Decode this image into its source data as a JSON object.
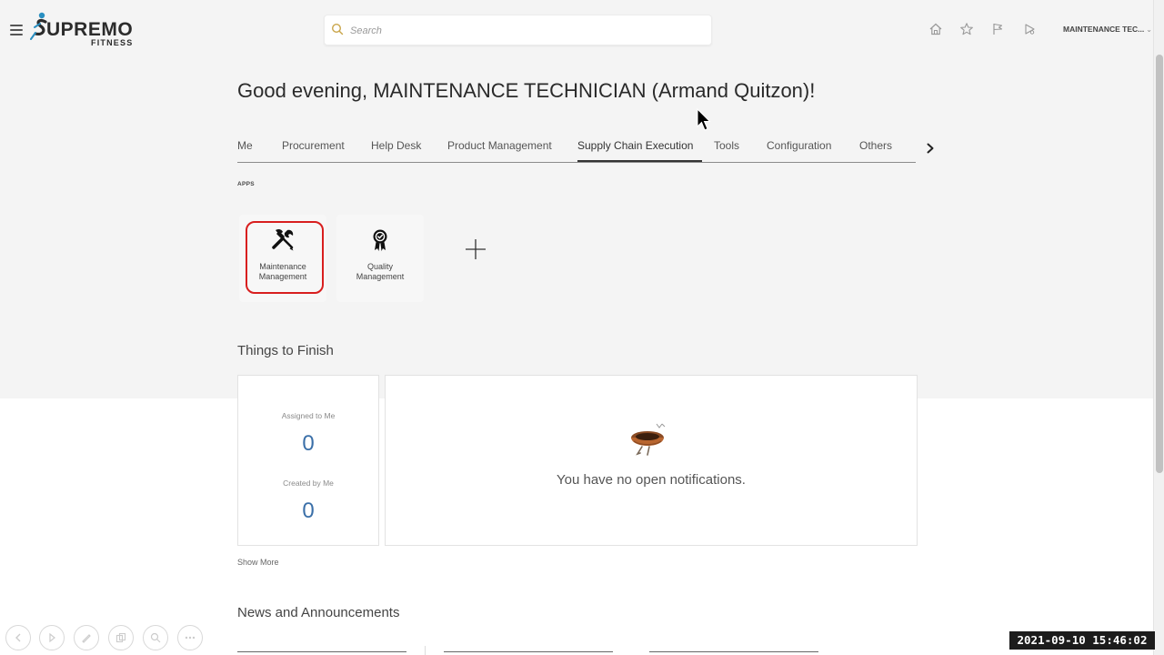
{
  "header": {
    "logo_text": "UPREMO",
    "logo_subtext": "FITNESS",
    "search_placeholder": "Search",
    "user_menu_label": "MAINTENANCE TEC...",
    "icons": [
      "home-icon",
      "star-icon",
      "flag-icon",
      "notifications-icon"
    ]
  },
  "greeting": "Good evening, MAINTENANCE TECHNICIAN (Armand Quitzon)!",
  "tabs": [
    {
      "label": "Me"
    },
    {
      "label": "Procurement"
    },
    {
      "label": "Help Desk"
    },
    {
      "label": "Product Management"
    },
    {
      "label": "Supply Chain Execution",
      "active": true
    },
    {
      "label": "Tools"
    },
    {
      "label": "Configuration"
    },
    {
      "label": "Others"
    }
  ],
  "apps": {
    "label": "APPS",
    "items": [
      {
        "line1": "Maintenance",
        "line2": "Management",
        "icon": "tools-icon",
        "selected": true
      },
      {
        "line1": "Quality",
        "line2": "Management",
        "icon": "award-icon"
      }
    ]
  },
  "things_to_finish": {
    "title": "Things to Finish",
    "assigned_label": "Assigned to Me",
    "assigned_count": "0",
    "created_label": "Created by Me",
    "created_count": "0",
    "empty_message": "You have no open notifications.",
    "show_more": "Show More"
  },
  "news": {
    "title": "News and Announcements"
  },
  "timestamp": "2021-09-10 15:46:02",
  "colors": {
    "selection": "#d81e1e",
    "count": "#3a6fa8",
    "page_bg": "#f4f4f4"
  }
}
